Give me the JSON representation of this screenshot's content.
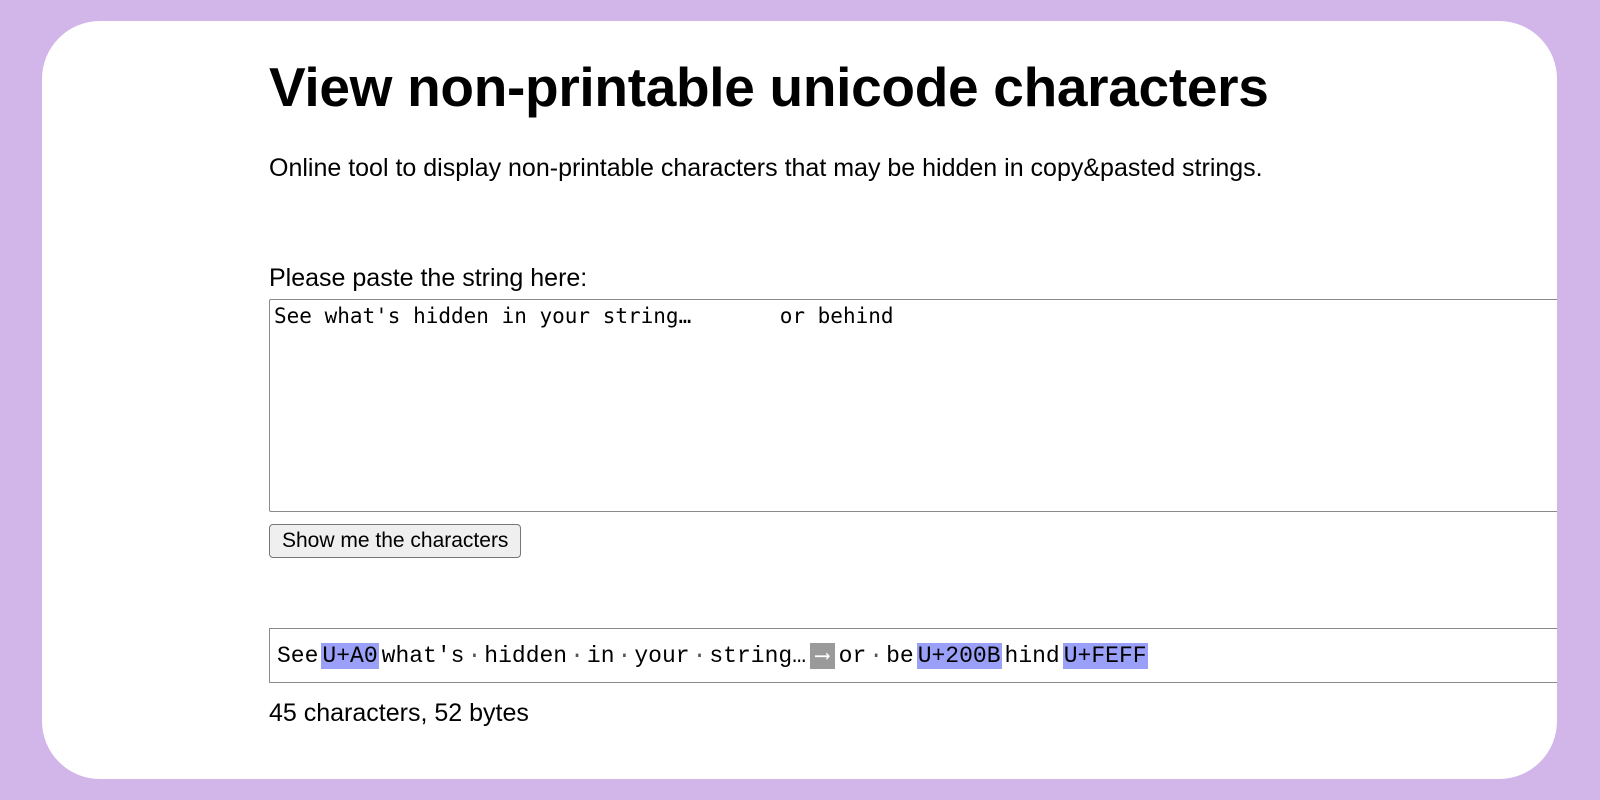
{
  "page": {
    "title": "View non-printable unicode characters",
    "subtitle": "Online tool to display non-printable characters that may be hidden in copy&pasted strings."
  },
  "input": {
    "label": "Please paste the string here:",
    "value": "See what's hidden in your string…       or behind"
  },
  "show_button_label": "Show me the characters",
  "output": {
    "tokens": [
      {
        "type": "text",
        "text": "See"
      },
      {
        "type": "code",
        "text": "U+A0"
      },
      {
        "type": "text",
        "text": "what's"
      },
      {
        "type": "dot",
        "text": "·"
      },
      {
        "type": "text",
        "text": "hidden"
      },
      {
        "type": "dot",
        "text": "·"
      },
      {
        "type": "text",
        "text": "in"
      },
      {
        "type": "dot",
        "text": "·"
      },
      {
        "type": "text",
        "text": "your"
      },
      {
        "type": "dot",
        "text": "·"
      },
      {
        "type": "text",
        "text": "string…"
      },
      {
        "type": "tab",
        "text": "⟶"
      },
      {
        "type": "text",
        "text": "or"
      },
      {
        "type": "dot",
        "text": "·"
      },
      {
        "type": "text",
        "text": "be"
      },
      {
        "type": "code",
        "text": "U+200B"
      },
      {
        "type": "text",
        "text": "hind"
      },
      {
        "type": "code",
        "text": "U+FEFF"
      }
    ]
  },
  "stats": "45 characters, 52 bytes",
  "colors": {
    "page_background": "#d2b6ea",
    "card_background": "#ffffff",
    "code_highlight": "#9aa0f8",
    "tab_highlight": "#9a9a9a"
  }
}
